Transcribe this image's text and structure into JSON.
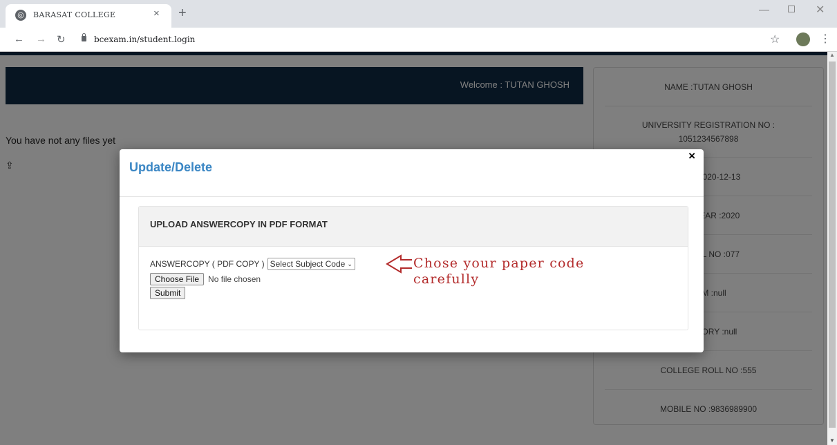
{
  "browser": {
    "tab_title": "BARASAT COLLEGE",
    "tab_close": "×",
    "new_tab": "+",
    "url": "bcexam.in/student.login",
    "icons": [
      "globe-icon",
      "back-arrow-icon",
      "forward-arrow-icon",
      "reload-icon",
      "lock-icon",
      "star-icon",
      "avatar",
      "kebab-menu-icon"
    ]
  },
  "header": {
    "welcome": "Welcome : TUTAN GHOSH"
  },
  "main": {
    "no_files": "You have not any files yet",
    "upload_icon": "upload-icon"
  },
  "profile": {
    "rows": [
      "NAME :TUTAN GHOSH",
      "UNIVERSITY REGISTRATION NO :",
      "1051234567898",
      "RTH :2020-12-13",
      "ION YEAR :2020",
      "Y ROLL NO :077",
      "EAM :null",
      "ATEGORY :null",
      "COLLEGE ROLL NO :555",
      "MOBILE NO :9836989900"
    ]
  },
  "modal": {
    "title": "Update/Delete",
    "close": "×",
    "panel_heading": "UPLOAD ANSWERCOPY IN PDF FORMAT",
    "field_label": "ANSWERCOPY ( PDF COPY )",
    "select_value": "Select Subject Code",
    "choose_file": "Choose File",
    "no_file": "No file chosen",
    "submit": "Submit"
  },
  "annotation": {
    "line1": "Chose your paper code",
    "line2": "carefully",
    "color": "#b32b2b"
  }
}
